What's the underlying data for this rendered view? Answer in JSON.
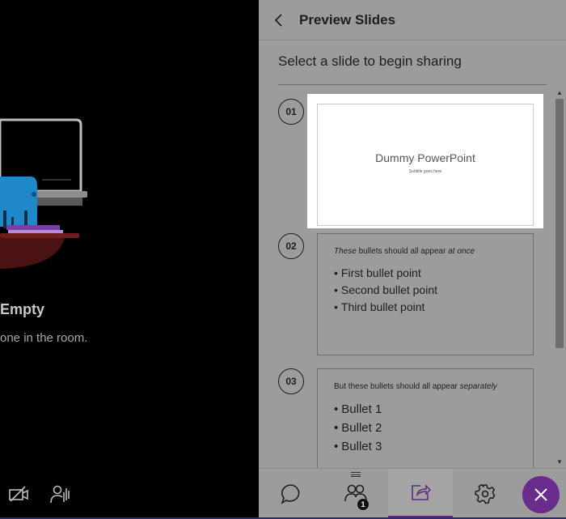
{
  "stage": {
    "room_title": "Empty",
    "room_message": "one in the room.",
    "controls": [
      {
        "icon": "camera-off-icon"
      },
      {
        "icon": "raise-hand-icon"
      }
    ]
  },
  "panel": {
    "title": "Preview Slides",
    "subtitle": "Select a slide to begin sharing",
    "slides": [
      {
        "number": "01",
        "selected": true,
        "title": "Dummy PowerPoint",
        "subtitle": "Subtitle goes here"
      },
      {
        "number": "02",
        "selected": false,
        "heading_italic_start": "These",
        "heading_middle": " bullets should all appear ",
        "heading_italic_end": "at once",
        "bullets": [
          "First bullet point",
          "Second bullet point",
          "Third bullet point"
        ]
      },
      {
        "number": "03",
        "selected": false,
        "heading_start": "But these bullets should all appear ",
        "heading_italic_end": "separately",
        "bullets": [
          "Bullet 1",
          "Bullet 2",
          "Bullet 3"
        ]
      }
    ]
  },
  "tabs": [
    {
      "icon": "chat-icon",
      "active": false
    },
    {
      "icon": "attendees-icon",
      "active": false,
      "badge": "1"
    },
    {
      "icon": "share-content-icon",
      "active": true
    },
    {
      "icon": "settings-gear-icon",
      "active": false
    }
  ],
  "colors": {
    "panel_bg": "#9c9c9c",
    "accent_purple": "#6a2c8c",
    "active_tab_underline": "#5e2a7e",
    "stage_bg": "#000000"
  }
}
